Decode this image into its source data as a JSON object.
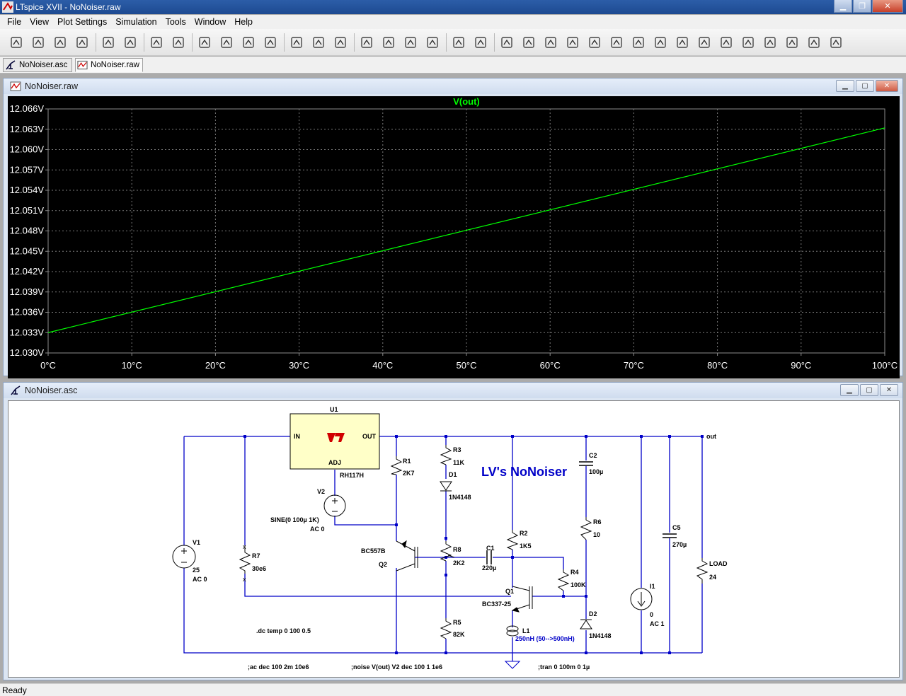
{
  "window": {
    "title": "LTspice XVII - NoNoiser.raw"
  },
  "menu": [
    "File",
    "View",
    "Plot Settings",
    "Simulation",
    "Tools",
    "Window",
    "Help"
  ],
  "toolbar_icons": [
    "new-schematic-icon",
    "open-icon",
    "save-icon",
    "control-panel-icon",
    "run-icon",
    "pan-hand-icon",
    "zoom-in-icon",
    "zoom-area-icon",
    "zoom-out-icon",
    "zoom-fit-icon",
    "autorange-icon",
    "waveform-icon",
    "tile-horizontal-icon",
    "cascade-icon",
    "tile-vertical-icon",
    "cut-icon",
    "copy-icon",
    "paste-icon",
    "find-icon",
    "print-icon",
    "print-setup-icon",
    "draw-wire-icon",
    "ground-icon",
    "label-net-icon",
    "resistor-icon",
    "capacitor-icon",
    "inductor-icon",
    "diode-icon",
    "component-icon",
    "move-icon",
    "drag-icon",
    "undo-icon",
    "redo-icon",
    "rotate-icon",
    "mirror-icon",
    "text-icon",
    "spice-directive-icon"
  ],
  "tabs": [
    {
      "label": "NoNoiser.asc",
      "active": false
    },
    {
      "label": "NoNoiser.raw",
      "active": true
    }
  ],
  "waveform_window": {
    "title": "NoNoiser.raw"
  },
  "schematic_window": {
    "title": "NoNoiser.asc"
  },
  "chart_data": {
    "type": "line",
    "title": "V(out)",
    "series": [
      {
        "name": "V(out)",
        "color": "#00ff00",
        "x": [
          0,
          100
        ],
        "y": [
          12.033,
          12.0632
        ]
      }
    ],
    "xlabel": "",
    "ylabel": "",
    "xlim": [
      0,
      100
    ],
    "ylim": [
      12.03,
      12.066
    ],
    "x_ticks": [
      "0°C",
      "10°C",
      "20°C",
      "30°C",
      "40°C",
      "50°C",
      "60°C",
      "70°C",
      "80°C",
      "90°C",
      "100°C"
    ],
    "y_ticks": [
      "12.066V",
      "12.063V",
      "12.060V",
      "12.057V",
      "12.054V",
      "12.051V",
      "12.048V",
      "12.045V",
      "12.042V",
      "12.039V",
      "12.036V",
      "12.033V",
      "12.030V"
    ],
    "grid": true,
    "background": "#000000",
    "label_color": "#ffffff"
  },
  "schematic": {
    "title": "LV's NoNoiser",
    "u1": {
      "ref": "U1",
      "part": "RH117H",
      "pin_in": "IN",
      "pin_out": "OUT",
      "pin_adj": "ADJ"
    },
    "v1": {
      "ref": "V1",
      "value": "25",
      "ac": "AC 0"
    },
    "v2": {
      "ref": "V2",
      "value": "SINE(0 100µ 1K)",
      "ac": "AC 0"
    },
    "i1": {
      "ref": "I1",
      "value": "0",
      "ac": "AC 1"
    },
    "r1": {
      "ref": "R1",
      "value": "2K7"
    },
    "r2": {
      "ref": "R2",
      "value": "1K5"
    },
    "r3": {
      "ref": "R3",
      "value": "11K"
    },
    "r4": {
      "ref": "R4",
      "value": "100K"
    },
    "r5": {
      "ref": "R5",
      "value": "82K"
    },
    "r6": {
      "ref": "R6",
      "value": "10"
    },
    "r7": {
      "ref": "R7",
      "value": "30e6"
    },
    "r8": {
      "ref": "R8",
      "value": "2K2"
    },
    "c1": {
      "ref": "C1",
      "value": "220µ"
    },
    "c2": {
      "ref": "C2",
      "value": "100µ"
    },
    "c5": {
      "ref": "C5",
      "value": "270µ"
    },
    "d1": {
      "ref": "D1",
      "value": "1N4148"
    },
    "d2": {
      "ref": "D2",
      "value": "1N4148"
    },
    "q1": {
      "ref": "Q1",
      "value": "BC337-25"
    },
    "q2": {
      "ref": "Q2",
      "value": "BC557B"
    },
    "l1": {
      "ref": "L1",
      "value": "250nH (50-->500nH)"
    },
    "load": {
      "ref": "LOAD",
      "value": "24"
    },
    "net_out": "out",
    "dir_dc": ".dc temp 0 100 0.5",
    "dir_ac": ";ac dec 100 2m 10e6",
    "dir_noise": ";noise V(out) V2 dec 100 1 1e6",
    "dir_tran": ";tran 0 100m 0 1µ"
  },
  "status": "Ready",
  "colors": {
    "wire": "#0000c8",
    "component": "#000000",
    "u1_fill": "#ffffc8",
    "trace": "#00ff00"
  }
}
